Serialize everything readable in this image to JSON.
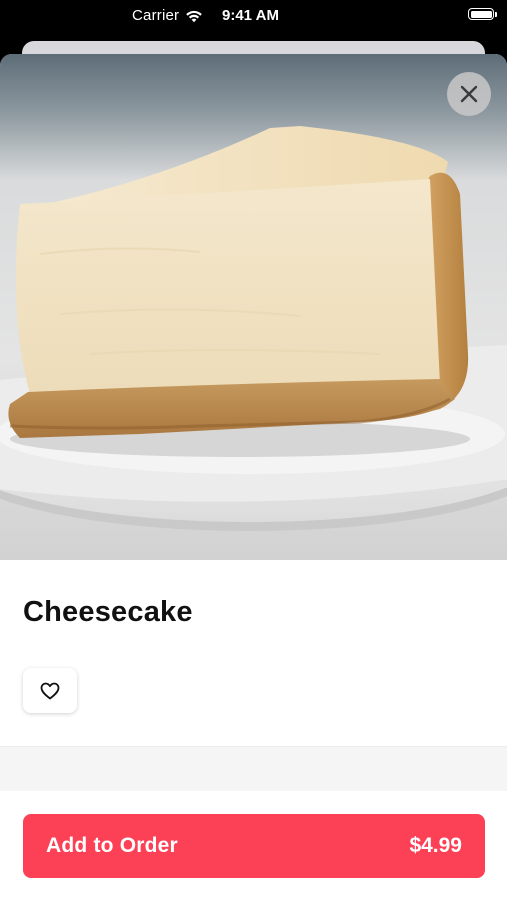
{
  "status_bar": {
    "carrier": "Carrier",
    "time": "9:41 AM",
    "icons": [
      "wifi-icon",
      "battery-icon"
    ],
    "battery_level": 1.0
  },
  "product": {
    "image_name": "cheesecake-photo",
    "title": "Cheesecake",
    "favorite_icon": "heart-outline-icon"
  },
  "header": {
    "close_icon": "close-icon"
  },
  "order": {
    "label": "Add to Order",
    "price": "$4.99",
    "color": "#fc4156"
  }
}
